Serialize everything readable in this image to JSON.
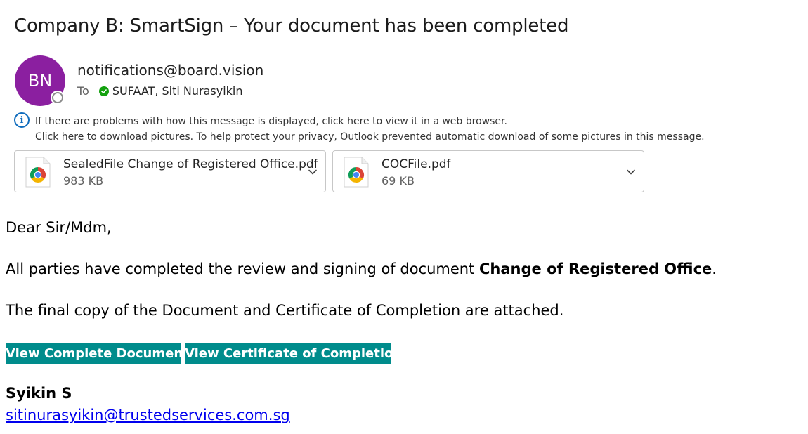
{
  "subject": "Company B: SmartSign – Your document has been completed",
  "sender": {
    "initials": "BN",
    "email": "notifications@board.vision",
    "avatar_color": "#8b1fa0"
  },
  "recipients": {
    "to_label": "To",
    "name": "SUFAAT, Siti Nurasyikin"
  },
  "info": {
    "line1": "If there are problems with how this message is displayed, click here to view it in a web browser.",
    "line2": "Click here to download pictures. To help protect your privacy, Outlook prevented automatic download of some pictures in this message."
  },
  "attachments": [
    {
      "name": "SealedFile Change of Registered Office.pdf",
      "size": "983 KB",
      "icon": "chrome-icon"
    },
    {
      "name": "COCFile.pdf",
      "size": "69 KB",
      "icon": "chrome-icon"
    }
  ],
  "body": {
    "greeting": "Dear Sir/Mdm,",
    "para1_prefix": "All parties have completed the review and signing of document ",
    "para1_bold": "Change of Registered Office",
    "para1_suffix": ".",
    "para2": "The final copy of the Document and Certificate of Completion are attached."
  },
  "buttons": {
    "view_document": "View Complete Document",
    "view_certificate": "View Certificate of Completion",
    "color": "#008c8c"
  },
  "signature": {
    "name": "Syikin S",
    "email": "sitinurasyikin@trustedservices.com.sg"
  }
}
